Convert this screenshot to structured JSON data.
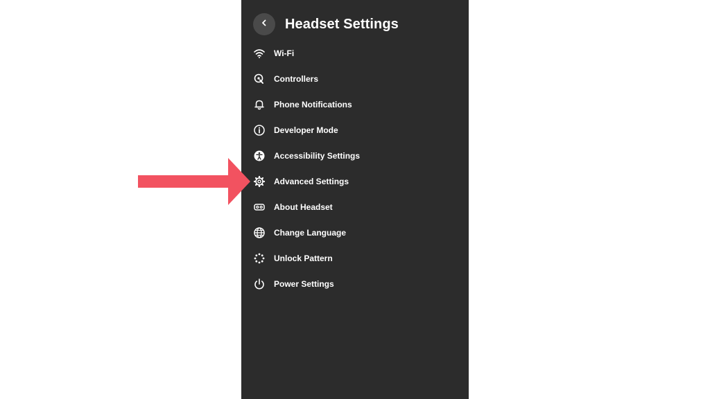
{
  "header": {
    "title": "Headset Settings",
    "back_icon": "chevron-left-icon"
  },
  "menu": {
    "items": [
      {
        "label": "Wi-Fi",
        "icon": "wifi-icon"
      },
      {
        "label": "Controllers",
        "icon": "controller-icon"
      },
      {
        "label": "Phone Notifications",
        "icon": "bell-icon"
      },
      {
        "label": "Developer Mode",
        "icon": "info-icon"
      },
      {
        "label": "Accessibility Settings",
        "icon": "accessibility-icon"
      },
      {
        "label": "Advanced Settings",
        "icon": "gear-icon"
      },
      {
        "label": "About Headset",
        "icon": "headset-icon"
      },
      {
        "label": "Change Language",
        "icon": "globe-icon"
      },
      {
        "label": "Unlock Pattern",
        "icon": "pattern-dots-icon"
      },
      {
        "label": "Power Settings",
        "icon": "power-icon"
      }
    ]
  },
  "annotation": {
    "icon": "arrow-right-icon",
    "points_to": "Advanced Settings"
  },
  "colors": {
    "background": "#ffffff",
    "panel": "#2c2c2c",
    "back_button": "#4a4a4a",
    "text": "#ffffff",
    "arrow": "#f25260"
  }
}
